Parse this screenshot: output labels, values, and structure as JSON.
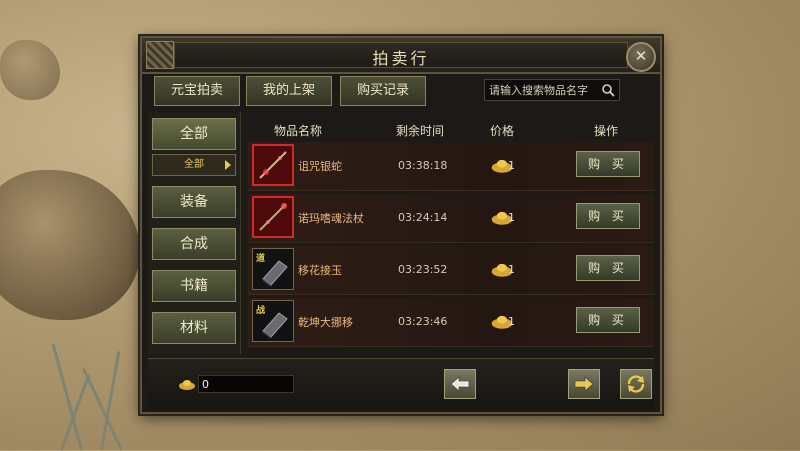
{
  "window": {
    "title": "拍卖行"
  },
  "tabs": [
    {
      "label": "元宝拍卖"
    },
    {
      "label": "我的上架"
    },
    {
      "label": "购买记录"
    }
  ],
  "search": {
    "placeholder": "请输入搜索物品名字",
    "icon": "search-icon"
  },
  "sidebar": {
    "items": [
      {
        "label": "全部",
        "active": true
      },
      {
        "label": "装备"
      },
      {
        "label": "合成"
      },
      {
        "label": "书籍"
      },
      {
        "label": "材料"
      }
    ],
    "sub_selected": "全部"
  },
  "columns": {
    "name": "物品名称",
    "time": "剩余时间",
    "price": "价格",
    "action": "操作"
  },
  "items": [
    {
      "name": "诅咒银蛇",
      "time": "03:38:18",
      "price": "1",
      "buy_label": "购 买",
      "icon": "red-weapon"
    },
    {
      "name": "诺玛嗜魂法杖",
      "time": "03:24:14",
      "price": "1",
      "buy_label": "购 买",
      "icon": "red-weapon"
    },
    {
      "name": "移花接玉",
      "time": "03:23:52",
      "price": "1",
      "buy_label": "购 买",
      "icon": "book",
      "tag": "道"
    },
    {
      "name": "乾坤大挪移",
      "time": "03:23:46",
      "price": "1",
      "buy_label": "购 买",
      "icon": "book",
      "tag": "战"
    }
  ],
  "footer": {
    "balance": "0"
  },
  "colors": {
    "accent": "#e8c850",
    "item_name": "#e8b880",
    "rare_border": "#d22828"
  }
}
